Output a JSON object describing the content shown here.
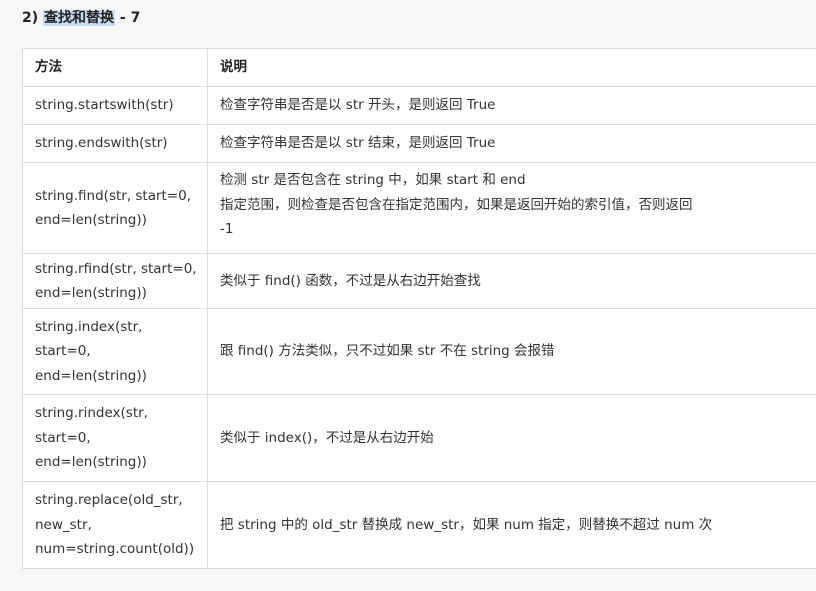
{
  "heading": {
    "prefix": "2) ",
    "highlight": "查找和替换",
    "suffix": " - 7"
  },
  "table": {
    "headers": [
      "方法",
      "说明"
    ],
    "rows": [
      {
        "method": [
          "string.startswith(str)"
        ],
        "desc": [
          "检查字符串是否是以 str 开头，是则返回 True"
        ]
      },
      {
        "method": [
          "string.endswith(str)"
        ],
        "desc": [
          "检查字符串是否是以 str 结束，是则返回 True"
        ]
      },
      {
        "method": [
          "string.find(str, start=0,",
          "end=len(string))"
        ],
        "desc": [
          "检测 str 是否包含在 string 中，如果 start 和 end",
          "指定范围，则检查是否包含在指定范围内，如果是返回开始的索引值，否则返回",
          "-1"
        ]
      },
      {
        "method": [
          "string.rfind(str, start=0,",
          "end=len(string))"
        ],
        "desc": [
          "类似于 find() 函数，不过是从右边开始查找"
        ]
      },
      {
        "method": [
          "string.index(str,",
          "start=0,",
          "end=len(string))"
        ],
        "desc": [
          "跟 find() 方法类似，只不过如果 str 不在 string 会报错"
        ]
      },
      {
        "method": [
          "string.rindex(str,",
          "start=0,",
          "end=len(string))"
        ],
        "desc": [
          "类似于 index()，不过是从右边开始"
        ]
      },
      {
        "method": [
          "string.replace(old_str,",
          "new_str,",
          "num=string.count(old))"
        ],
        "desc": [
          "把 string 中的 old_str 替换成 new_str，如果 num 指定，则替换不超过 num 次"
        ]
      }
    ]
  }
}
